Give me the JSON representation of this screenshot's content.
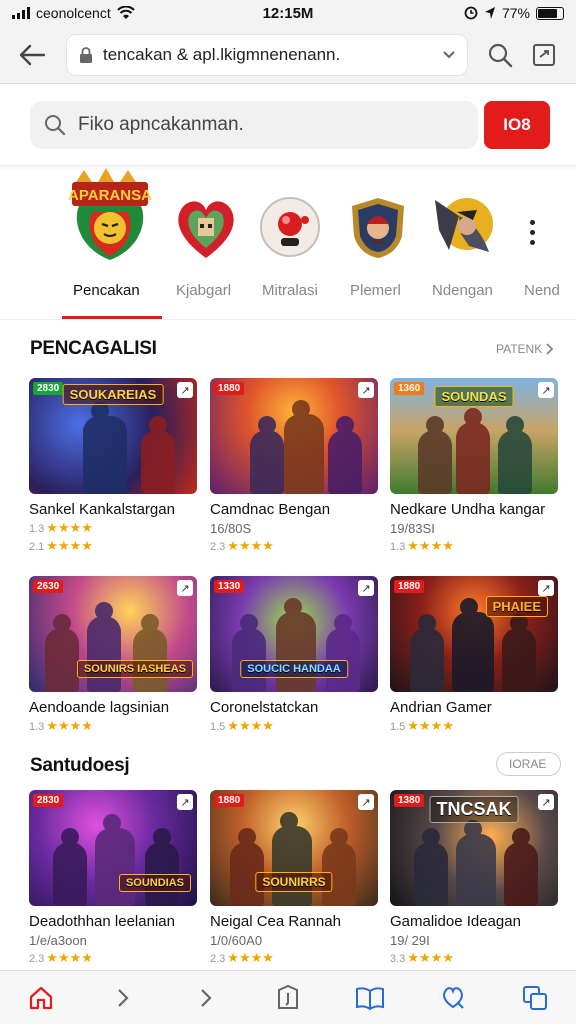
{
  "status_bar": {
    "carrier": "ceonolcenct",
    "time": "12:15M",
    "battery_percent": "77%"
  },
  "browser": {
    "url": "tencakan & apl.lkigmnenenann.",
    "back_icon": "arrow-left-icon",
    "lock_icon": "lock-icon",
    "dropdown_icon": "chevron-down-icon",
    "search_icon": "search-icon",
    "tabs_icon": "tab-switch-icon"
  },
  "search": {
    "placeholder": "Fiko apncakanman.",
    "button_label": "IO8",
    "button_color": "#e21b1b"
  },
  "categories": [
    {
      "icon": "game-logo-icon",
      "label": "APARANSA"
    },
    {
      "icon": "heart-game-icon"
    },
    {
      "icon": "joystick-icon"
    },
    {
      "icon": "warrior-shield-icon"
    },
    {
      "icon": "dragon-emblem-icon"
    }
  ],
  "tabs": [
    {
      "label": "Pencakan",
      "active": true
    },
    {
      "label": "Kjabgarl",
      "active": false
    },
    {
      "label": "Mitralasi",
      "active": false
    },
    {
      "label": "Plemerl",
      "active": false
    },
    {
      "label": "Ndengan",
      "active": false
    },
    {
      "label": "Nend",
      "active": false
    }
  ],
  "section1": {
    "title": "PENCAGALISI",
    "link": "PATENK",
    "cards": [
      {
        "badge": "2830",
        "badge_color": "#17a53a",
        "banner": "SOUKAREIAS",
        "name": "Sankel Kankalstargan",
        "sub": "",
        "rating_a": "1.3",
        "rating_b": "2.1"
      },
      {
        "badge": "1880",
        "badge_color": "#e21b1b",
        "banner": "",
        "name": "Camdnac Bengan",
        "sub": "16/80S",
        "rating_a": "2.3",
        "rating_b": ""
      },
      {
        "badge": "1360",
        "badge_color": "#f07c1a",
        "banner": "SOUNDAS",
        "name": "Nedkare Undha kangar",
        "sub": "19/83SI",
        "rating_a": "1.3",
        "rating_b": ""
      },
      {
        "badge": "2630",
        "badge_color": "#e21b1b",
        "banner": "SOUNIRS IASHEAS",
        "name": "Aendoande lagsinian",
        "sub": "",
        "rating_a": "1.3",
        "rating_b": ""
      },
      {
        "badge": "1330",
        "badge_color": "#e21b1b",
        "banner": "SOUCIC HANDAA",
        "name": "Coronelstatckan",
        "sub": "",
        "rating_a": "1.5",
        "rating_b": ""
      },
      {
        "badge": "1880",
        "badge_color": "#e21b1b",
        "banner": "PHAIEE",
        "name": "Andrian Gamer",
        "sub": "",
        "rating_a": "1.5",
        "rating_b": ""
      }
    ]
  },
  "section2": {
    "title": "Santudoesj",
    "link": "IORAE",
    "cards": [
      {
        "badge": "2830",
        "badge_color": "#e21b1b",
        "banner": "SOUNDIAS",
        "name": "Deadothhan leelanian",
        "sub": "1/e/a3oon",
        "rating_a": "2.3",
        "rating_b": ""
      },
      {
        "badge": "1880",
        "badge_color": "#e21b1b",
        "banner": "SOUNIRRS",
        "name": "Neigal Cea Rannah",
        "sub": "1/0/60A0",
        "rating_a": "2.3",
        "rating_b": ""
      },
      {
        "badge": "1380",
        "badge_color": "#e21b1b",
        "banner": "TNCSAK",
        "name": "Gamalidoe Ideagan",
        "sub": "19/ 29I",
        "rating_a": "3.3",
        "rating_b": ""
      }
    ]
  },
  "bottom_nav": [
    {
      "icon": "home-icon",
      "active": true
    },
    {
      "icon": "chevron-right-icon"
    },
    {
      "icon": "chevron-right-icon"
    },
    {
      "icon": "compass-icon"
    },
    {
      "icon": "bookmarks-icon"
    },
    {
      "icon": "tag-icon"
    },
    {
      "icon": "copy-tabs-icon"
    }
  ]
}
